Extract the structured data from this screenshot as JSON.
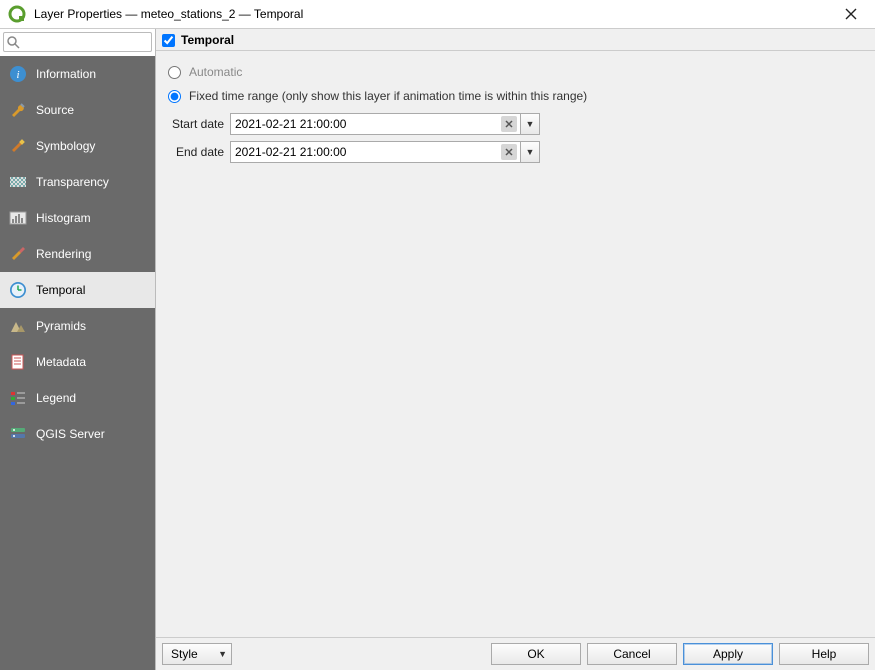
{
  "window": {
    "title": "Layer Properties — meteo_stations_2 — Temporal"
  },
  "search": {
    "placeholder": ""
  },
  "sidebar": {
    "items": [
      {
        "label": "Information"
      },
      {
        "label": "Source"
      },
      {
        "label": "Symbology"
      },
      {
        "label": "Transparency"
      },
      {
        "label": "Histogram"
      },
      {
        "label": "Rendering"
      },
      {
        "label": "Temporal"
      },
      {
        "label": "Pyramids"
      },
      {
        "label": "Metadata"
      },
      {
        "label": "Legend"
      },
      {
        "label": "QGIS Server"
      }
    ],
    "active_index": 6
  },
  "panel": {
    "title": "Temporal",
    "checked": true,
    "radios": {
      "automatic": "Automatic",
      "fixed": "Fixed time range (only show this layer if animation time is within this range)"
    },
    "selected_radio": "fixed",
    "start": {
      "label": "Start date",
      "value": "2021-02-21 21:00:00"
    },
    "end": {
      "label": "End date",
      "value": "2021-02-21 21:00:00"
    }
  },
  "footer": {
    "style": "Style",
    "ok": "OK",
    "cancel": "Cancel",
    "apply": "Apply",
    "help": "Help"
  }
}
